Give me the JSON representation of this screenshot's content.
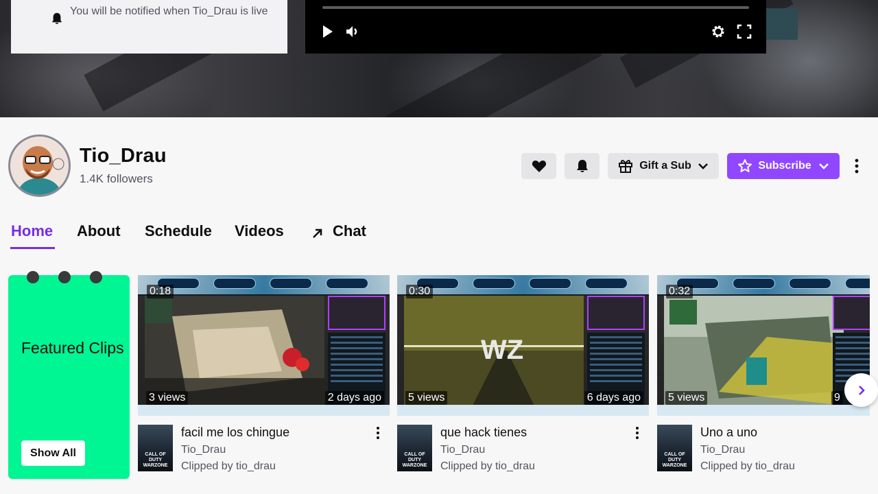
{
  "notification": {
    "text": "You will be notified when Tio_Drau is live"
  },
  "channel": {
    "name": "Tio_Drau",
    "followers": "1.4K followers"
  },
  "actions": {
    "gift_sub": "Gift a Sub",
    "subscribe": "Subscribe",
    "accent": "#9147ff"
  },
  "tabs": [
    {
      "label": "Home",
      "active": true
    },
    {
      "label": "About"
    },
    {
      "label": "Schedule"
    },
    {
      "label": "Videos"
    },
    {
      "label": "Chat",
      "icon": "external-arrow-icon"
    }
  ],
  "featured": {
    "title": "Featured Clips",
    "show_all": "Show All",
    "color": "#00f593"
  },
  "clips": [
    {
      "duration": "0:18",
      "views": "3 views",
      "age": "2 days ago",
      "title": "facil me los chingue",
      "channel": "Tio_Drau",
      "clipped_by": "Clipped by tio_drau"
    },
    {
      "duration": "0:30",
      "views": "5 views",
      "age": "6 days ago",
      "title": "que hack tienes",
      "channel": "Tio_Drau",
      "clipped_by": "Clipped by tio_drau"
    },
    {
      "duration": "0:32",
      "views": "5 views",
      "age": "9",
      "title": "Uno a uno",
      "channel": "Tio_Drau",
      "clipped_by": "Clipped by tio_drau"
    }
  ],
  "game_box_text": "CALL OF DUTY WARZONE",
  "wz_text": "WZ"
}
